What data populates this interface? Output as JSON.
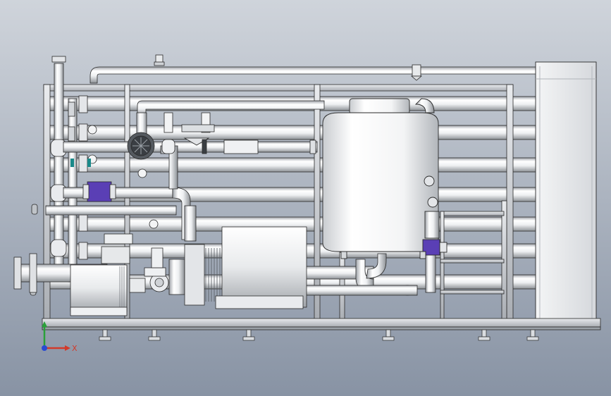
{
  "view": {
    "background_top": "#c9ced6",
    "background_bottom": "#8a95a6",
    "metal_light": "#ffffff",
    "metal_mid": "#e6e8ea",
    "metal_dark": "#8c9096",
    "outline": "#2a2a2a",
    "accent_violet": "#5a3fb5",
    "accent_teal": "#1a8a8a"
  },
  "triad": {
    "x_label": "X",
    "x_color": "#d23a2a",
    "y_color": "#2aa03a",
    "z_color": "#2a4bd2"
  }
}
